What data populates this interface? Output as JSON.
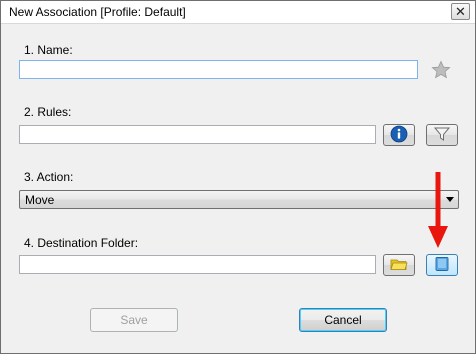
{
  "window": {
    "title": "New Association [Profile: Default]",
    "close_glyph": "✕"
  },
  "fields": {
    "name_label": "1. Name:",
    "name_value": "",
    "rules_label": "2. Rules:",
    "rules_value": "",
    "action_label": "3. Action:",
    "action_value": "Move",
    "destination_label": "4. Destination Folder:",
    "destination_value": ""
  },
  "icons": {
    "favorite": "star-icon",
    "info": "info-icon",
    "filter": "filter-icon",
    "browse_folder": "folder-icon",
    "select_folder": "folder-select-icon"
  },
  "buttons": {
    "save_label": "Save",
    "cancel_label": "Cancel"
  },
  "colors": {
    "annotation_arrow": "#e8160c",
    "info_blue": "#1a5fb4",
    "folder_yellow": "#f2d23a"
  }
}
